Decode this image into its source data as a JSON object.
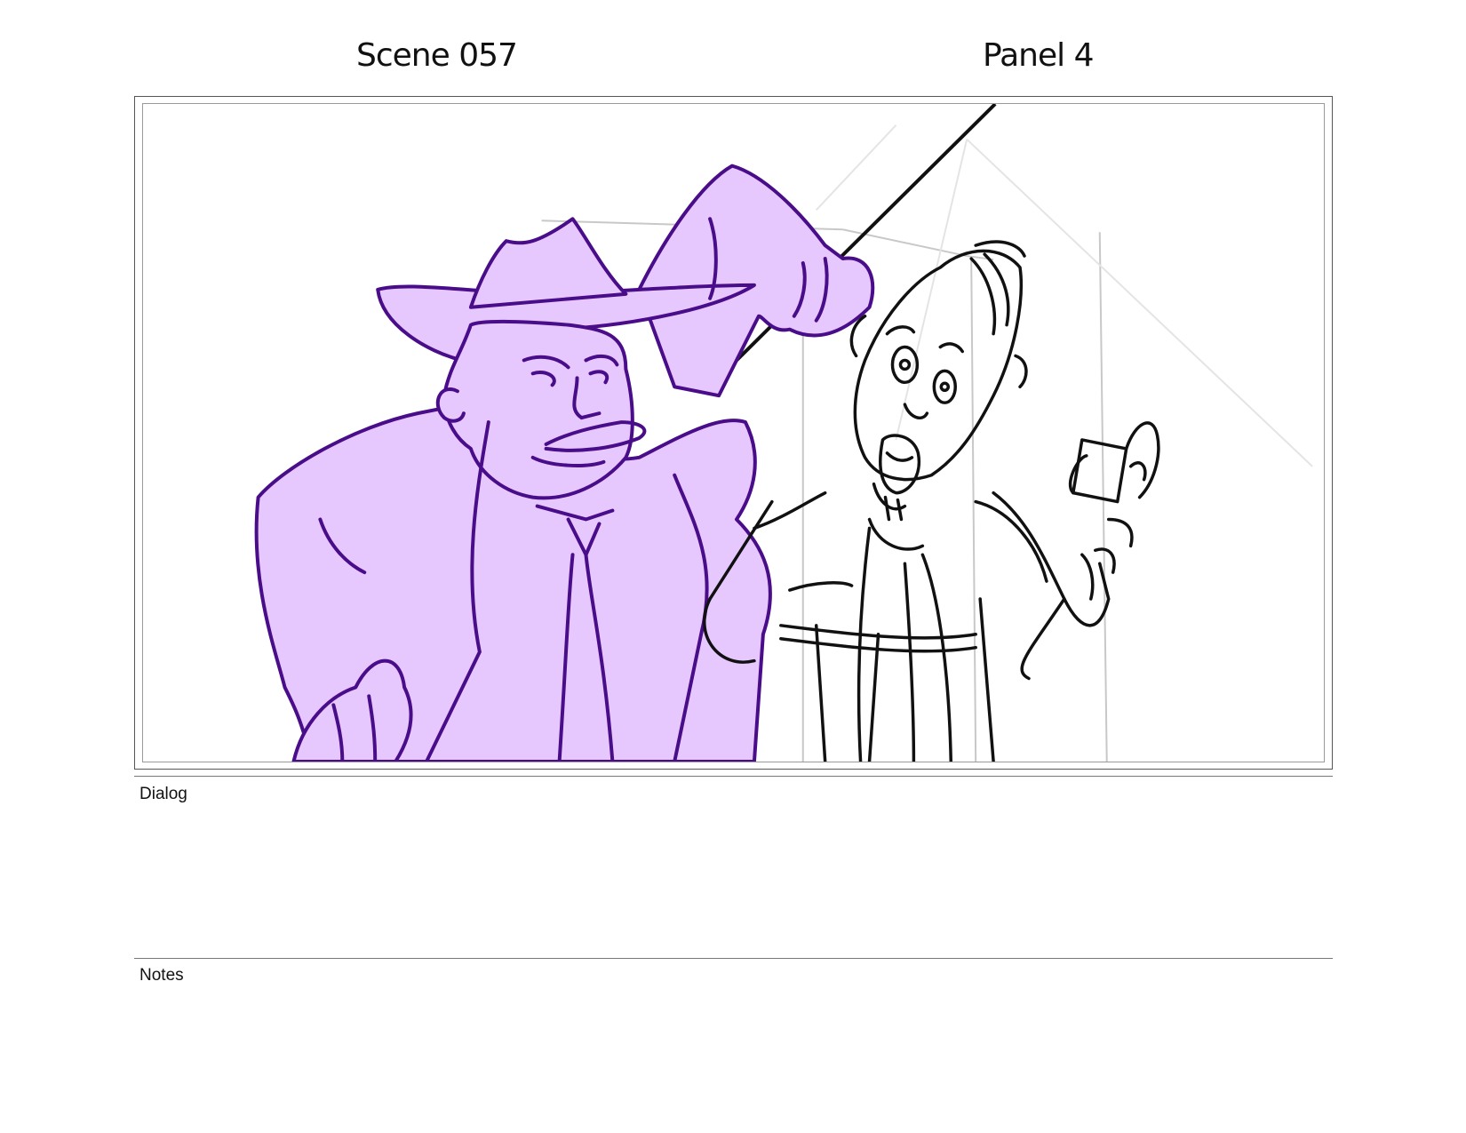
{
  "header": {
    "scene_label": "Scene 057",
    "panel_label": "Panel 4"
  },
  "panel": {
    "illustration": "storyboard-sketch",
    "colors": {
      "highlight_fill": "#e6c8ff",
      "highlight_line": "#4a0d8a",
      "sketch_line": "#111111",
      "guide_line": "#bdbdbd"
    }
  },
  "dialog": {
    "label": "Dialog",
    "text": ""
  },
  "notes": {
    "label": "Notes",
    "text": ""
  }
}
